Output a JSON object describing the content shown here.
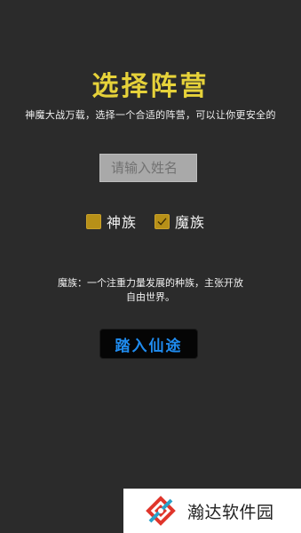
{
  "header": {
    "title": "选择阵营",
    "subtitle": "神魔大战万载，选择一个合适的阵营，可以让你更安全的"
  },
  "name_input": {
    "placeholder": "请输入姓名",
    "value": ""
  },
  "factions": {
    "shen": {
      "label": "神族",
      "checked": false
    },
    "mo": {
      "label": "魔族",
      "checked": true
    }
  },
  "description": {
    "line1": "魔族：一个注重力量发展的种族，主张开放",
    "line2": "自由世界。"
  },
  "enter_button": {
    "label": "踏入仙途"
  },
  "watermark": {
    "text": "瀚达软件园",
    "logo_icon": "handa-logo-icon"
  },
  "colors": {
    "background": "#2b2b2b",
    "title": "#e6d23a",
    "checkbox": "#b79018",
    "button_text": "#1f8cf0",
    "button_bg": "#050505"
  }
}
